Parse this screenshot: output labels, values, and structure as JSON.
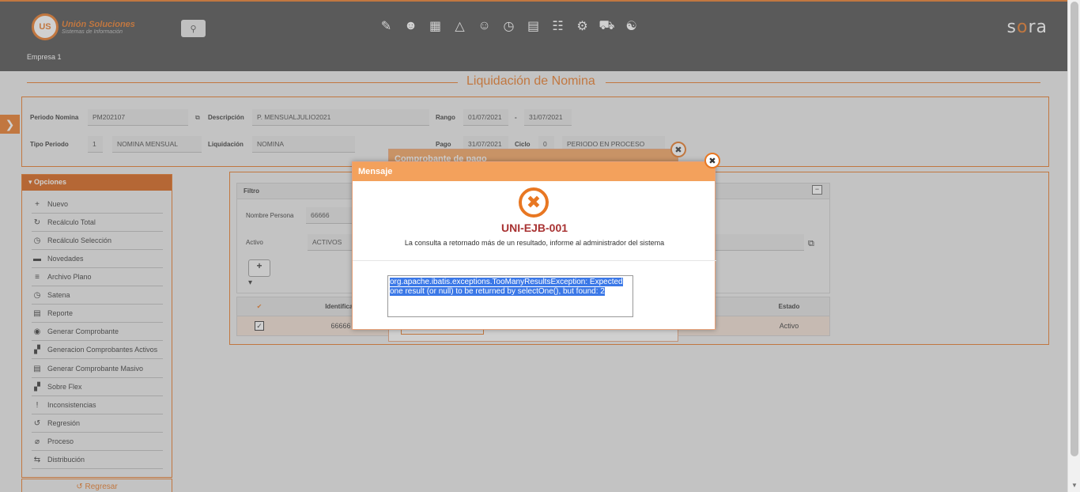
{
  "header": {
    "logo_abbr": "US",
    "logo_title": "Unión Soluciones",
    "logo_subtitle": "Sistemas de Información",
    "company": "Empresa 1",
    "brand_prefix": "s",
    "brand_o": "o",
    "brand_suffix": "ra",
    "search_icon": "search-icon",
    "nav_icons": [
      "edit-document-icon",
      "person-money-icon",
      "gift-icon",
      "org-chart-icon",
      "team-icon",
      "timer-icon",
      "report-icon",
      "presenter-icon",
      "gears-icon",
      "car-location-icon",
      "group-icon"
    ]
  },
  "page": {
    "title": "Liquidación de Nomina"
  },
  "period": {
    "periodo_label": "Periodo Nomina",
    "periodo_value": "PM202107",
    "descripcion_label": "Descripción",
    "descripcion_value": "P. MENSUALJULIO2021",
    "rango_label": "Rango",
    "rango_from": "01/07/2021",
    "rango_sep": "-",
    "rango_to": "31/07/2021",
    "tipo_label": "Tipo Periodo",
    "tipo_code": "1",
    "tipo_value": "NOMINA MENSUAL",
    "liquidacion_label": "Liquidación",
    "liquidacion_value": "NOMINA",
    "pago_label": "Pago",
    "pago_value": "31/07/2021",
    "ciclo_label": "Ciclo",
    "ciclo_value": "0",
    "estado_value": "PERIODO EN PROCESO"
  },
  "options": {
    "header": "Opciones",
    "items": [
      {
        "label": "Nuevo",
        "icon": "+"
      },
      {
        "label": "Recálculo Total",
        "icon": "↻"
      },
      {
        "label": "Recálculo Selección",
        "icon": "◷"
      },
      {
        "label": "Novedades",
        "icon": "▬"
      },
      {
        "label": "Archivo Plano",
        "icon": "≡"
      },
      {
        "label": "Satena",
        "icon": "◷"
      },
      {
        "label": "Reporte",
        "icon": "▤"
      },
      {
        "label": "Generar Comprobante",
        "icon": "◉"
      },
      {
        "label": "Generacion Comprobantes Activos",
        "icon": "▞"
      },
      {
        "label": "Generar Comprobante Masivo",
        "icon": "▤"
      },
      {
        "label": "Sobre Flex",
        "icon": "▞"
      },
      {
        "label": "Inconsistencias",
        "icon": "!"
      },
      {
        "label": "Regresión",
        "icon": "↺"
      },
      {
        "label": "Proceso",
        "icon": "⌀"
      },
      {
        "label": "Distribución",
        "icon": "⇆"
      }
    ],
    "back_label": "Regresar"
  },
  "filtro": {
    "title": "Filtro",
    "nombre_label": "Nombre Persona",
    "nombre_value": "66666",
    "activo_label": "Activo",
    "activo_value": "ACTIVOS",
    "add_label": "+"
  },
  "grid": {
    "check_header": "✔",
    "col_ident": "Identificac",
    "col_estado": "Estado",
    "row_ident": "66666",
    "row_estado": "Activo"
  },
  "bg_dialog": {
    "title": "Comprobante de pago"
  },
  "modal": {
    "title": "Mensaje",
    "code": "UNI-EJB-001",
    "message": "La consulta a retornado más de un resultado, informe al administrador del sistema",
    "detail": "org.apache.ibatis.exceptions.TooManyResultsException: Expected one result (or null) to be returned by selectOne(), but found: 2"
  }
}
